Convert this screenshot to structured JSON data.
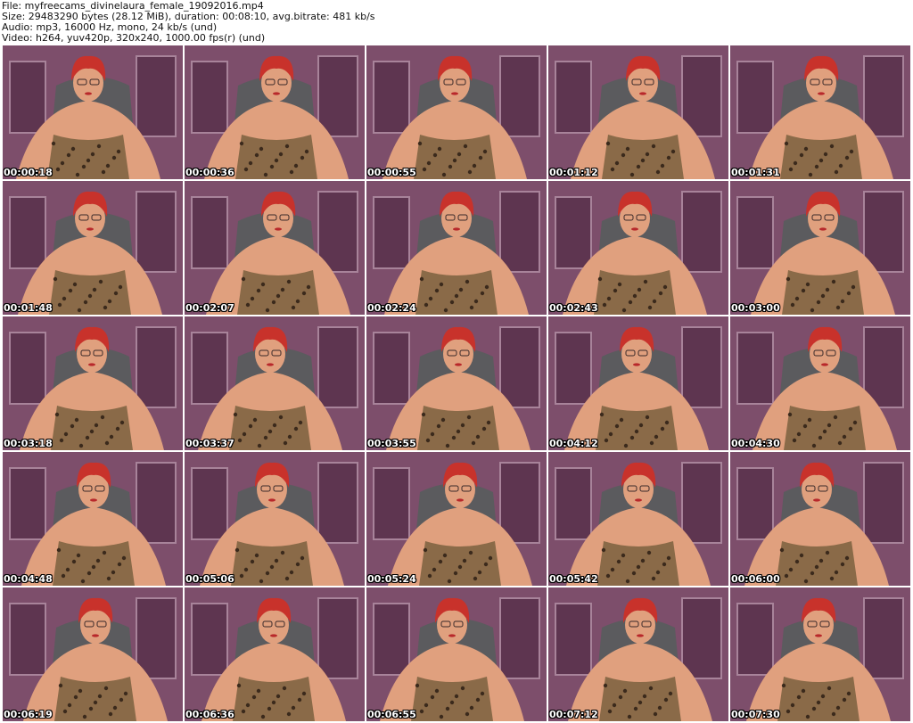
{
  "header": {
    "file": "File: myfreecams_divinelaura_female_19092016.mp4",
    "size": "Size: 29483290 bytes (28.12 MiB), duration: 00:08:10, avg.bitrate: 481 kb/s",
    "audio": "Audio: mp3, 16000 Hz, mono, 24 kb/s (und)",
    "video": "Video: h264, yuv420p, 320x240, 1000.00 fps(r) (und)"
  },
  "thumbnails": [
    {
      "timestamp": "00:00:18"
    },
    {
      "timestamp": "00:00:36"
    },
    {
      "timestamp": "00:00:55"
    },
    {
      "timestamp": "00:01:12"
    },
    {
      "timestamp": "00:01:31"
    },
    {
      "timestamp": "00:01:48"
    },
    {
      "timestamp": "00:02:07"
    },
    {
      "timestamp": "00:02:24"
    },
    {
      "timestamp": "00:02:43"
    },
    {
      "timestamp": "00:03:00"
    },
    {
      "timestamp": "00:03:18"
    },
    {
      "timestamp": "00:03:37"
    },
    {
      "timestamp": "00:03:55"
    },
    {
      "timestamp": "00:04:12"
    },
    {
      "timestamp": "00:04:30"
    },
    {
      "timestamp": "00:04:48"
    },
    {
      "timestamp": "00:05:06"
    },
    {
      "timestamp": "00:05:24"
    },
    {
      "timestamp": "00:05:42"
    },
    {
      "timestamp": "00:06:00"
    },
    {
      "timestamp": "00:06:19"
    },
    {
      "timestamp": "00:06:36"
    },
    {
      "timestamp": "00:06:55"
    },
    {
      "timestamp": "00:07:12"
    },
    {
      "timestamp": "00:07:30"
    }
  ],
  "colors": {
    "wall": "#7d4e6b",
    "wall_dark": "#5e3550",
    "wall_trim": "#a8839a",
    "chair": "#5b5b5e",
    "skin": "#e0a07e",
    "hair": "#c8322b",
    "dress": "#8a6a48",
    "dress_spot": "#3b2a1c",
    "timestamp_text": "#ffffff"
  }
}
